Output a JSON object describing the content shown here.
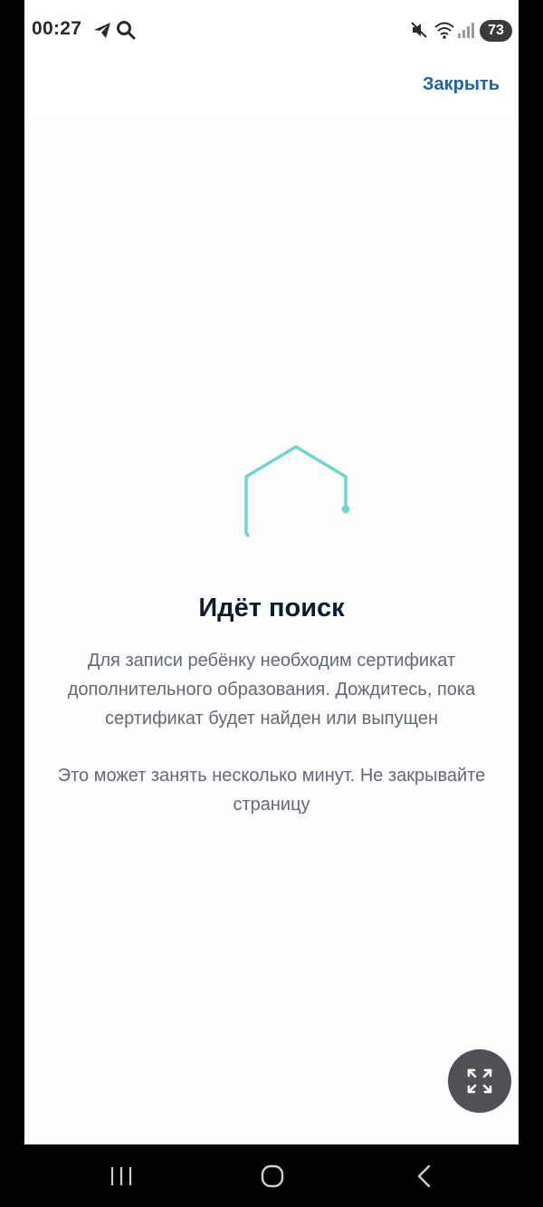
{
  "status_bar": {
    "time": "00:27",
    "battery": "73",
    "icons": [
      "telegram-icon",
      "search-icon",
      "mute-icon",
      "wifi-icon",
      "signal-icon"
    ]
  },
  "header": {
    "close_label": "Закрыть"
  },
  "loader": {
    "icon": "hexagon-spinner-icon",
    "color": "#6fd6cd"
  },
  "content": {
    "title": "Идёт поиск",
    "description_line1": "Для записи ребёнку необходим сертификат",
    "description_line2": "дополнительного образования. Дождитесь, пока",
    "description_line3": "сертификат будет найден или выпущен",
    "note_line1": "Это может занять несколько минут. Не закрывайте",
    "note_line2": "страницу"
  },
  "fab": {
    "icon": "expand-icon"
  },
  "navigation_bar": {
    "buttons": [
      "recent-apps-icon",
      "home-icon",
      "back-icon"
    ]
  }
}
